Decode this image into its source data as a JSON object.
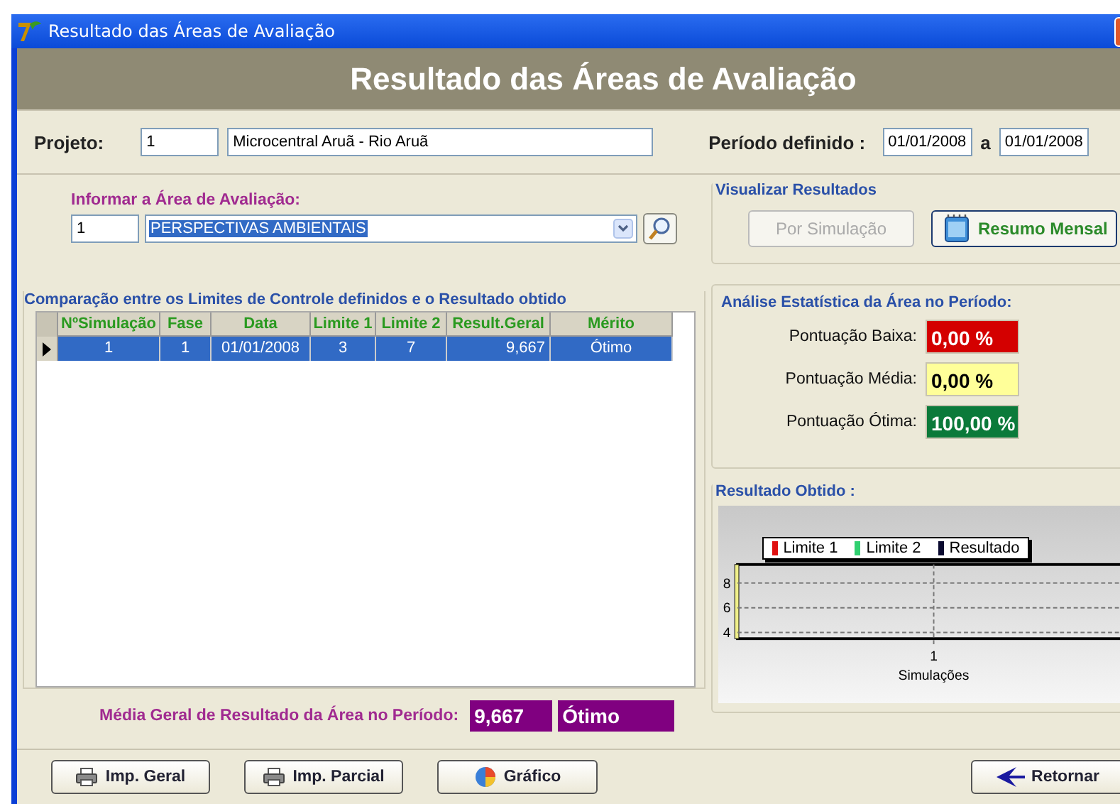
{
  "window": {
    "title": "Resultado das Áreas de Avaliação"
  },
  "header": {
    "title": "Resultado das Áreas de Avaliação"
  },
  "project": {
    "label": "Projeto:",
    "code": "1",
    "name": "Microcentral Aruã - Rio Aruã",
    "period_label": "Período definido :",
    "start": "01/01/2008",
    "separator": "a",
    "end": "01/01/2008"
  },
  "area": {
    "label": "Informar a Área de Avaliação:",
    "code": "1",
    "value": "PERSPECTIVAS AMBIENTAIS"
  },
  "view_results": {
    "title": "Visualizar Resultados",
    "buttons": [
      {
        "label": "Por Simulação",
        "disabled": true
      },
      {
        "label": "Resumo Mensal",
        "disabled": false
      }
    ]
  },
  "table": {
    "title": "Comparação entre os Limites de Controle definidos e o Resultado obtido",
    "columns": [
      "NºSimulação",
      "Fase",
      "Data",
      "Limite 1",
      "Limite 2",
      "Result.Geral",
      "Mérito"
    ],
    "rows": [
      {
        "selected": true,
        "cells": [
          "1",
          "1",
          "01/01/2008",
          "3",
          "7",
          "9,667",
          "Ótimo"
        ]
      }
    ]
  },
  "average": {
    "label": "Média Geral de Resultado da Área no Período:",
    "value": "9,667",
    "merit": "Ótimo"
  },
  "statistics": {
    "title": "Análise Estatística da Área no Período:",
    "items": [
      {
        "label": "Pontuação Baixa:",
        "value": "0,00 %",
        "color": "#d40000"
      },
      {
        "label": "Pontuação Média:",
        "value": "0,00 %",
        "color": "#ffff99"
      },
      {
        "label": "Pontuação Ótima:",
        "value": "100,00 %",
        "color": "#0b7a3a"
      }
    ]
  },
  "result_chart": {
    "title": "Resultado Obtido :",
    "chart_data": {
      "type": "bar",
      "grid": true,
      "categories": [
        "1"
      ],
      "xlabel": "Simulações",
      "yticks": [
        4,
        6,
        8
      ],
      "ylim": [
        3.5,
        9.5
      ],
      "series": [
        {
          "name": "Limite 1",
          "color": "#e01010",
          "values": [
            null
          ]
        },
        {
          "name": "Limite 2",
          "color": "#30d070",
          "values": [
            null
          ]
        },
        {
          "name": "Resultado",
          "color": "#0a0a30",
          "values": [
            null
          ]
        }
      ]
    }
  },
  "footer": {
    "buttons": [
      {
        "label": "Imp. Geral",
        "kind": "print"
      },
      {
        "label": "Imp. Parcial",
        "kind": "print"
      },
      {
        "label": "Gráfico",
        "kind": "chart"
      },
      {
        "label": "Retornar",
        "kind": "back"
      }
    ]
  }
}
